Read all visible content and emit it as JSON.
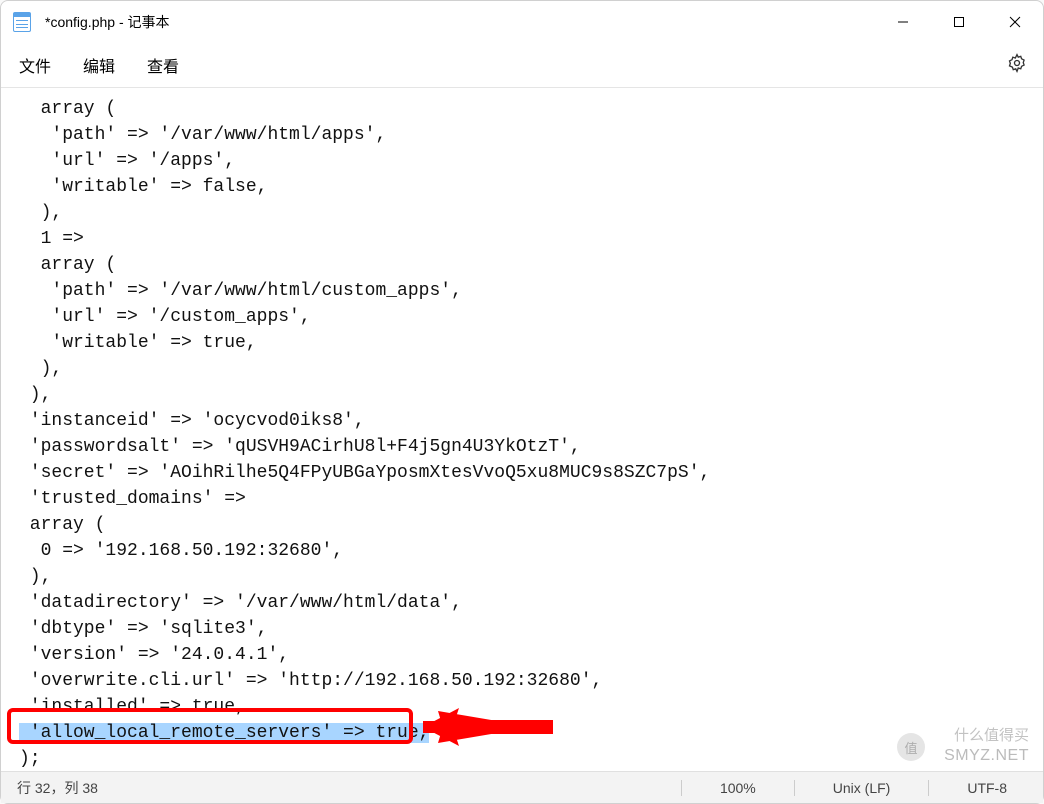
{
  "window": {
    "title": "*config.php - 记事本"
  },
  "menu": {
    "file": "文件",
    "edit": "编辑",
    "view": "查看"
  },
  "code": {
    "line1": "  array (",
    "line2": "   'path' => '/var/www/html/apps',",
    "line3": "   'url' => '/apps',",
    "line4": "   'writable' => false,",
    "line5": "  ),",
    "line6": "  1 =>",
    "line7": "  array (",
    "line8": "   'path' => '/var/www/html/custom_apps',",
    "line9": "   'url' => '/custom_apps',",
    "line10": "   'writable' => true,",
    "line11": "  ),",
    "line12": " ),",
    "line13": " 'instanceid' => 'ocycvod0iks8',",
    "line14": " 'passwordsalt' => 'qUSVH9ACirhU8l+F4j5gn4U3YkOtzT',",
    "line15": " 'secret' => 'AOihRilhe5Q4FPyUBGaYposmXtesVvoQ5xu8MUC9s8SZC7pS',",
    "line16": " 'trusted_domains' =>",
    "line17": " array (",
    "line18": "  0 => '192.168.50.192:32680',",
    "line19": " ),",
    "line20": " 'datadirectory' => '/var/www/html/data',",
    "line21": " 'dbtype' => 'sqlite3',",
    "line22": " 'version' => '24.0.4.1',",
    "line23": " 'overwrite.cli.url' => 'http://192.168.50.192:32680',",
    "line24": " 'installed' => true,",
    "line25_highlight": " 'allow_local_remote_servers' => true,",
    "line26": ");"
  },
  "statusbar": {
    "position": "行 32，列 38",
    "zoom": "100%",
    "encoding_mode": "Unix (LF)",
    "encoding": "UTF-8"
  },
  "watermark": {
    "cn": "什么值得买",
    "en": "SMYZ.NET",
    "icon": "值"
  }
}
